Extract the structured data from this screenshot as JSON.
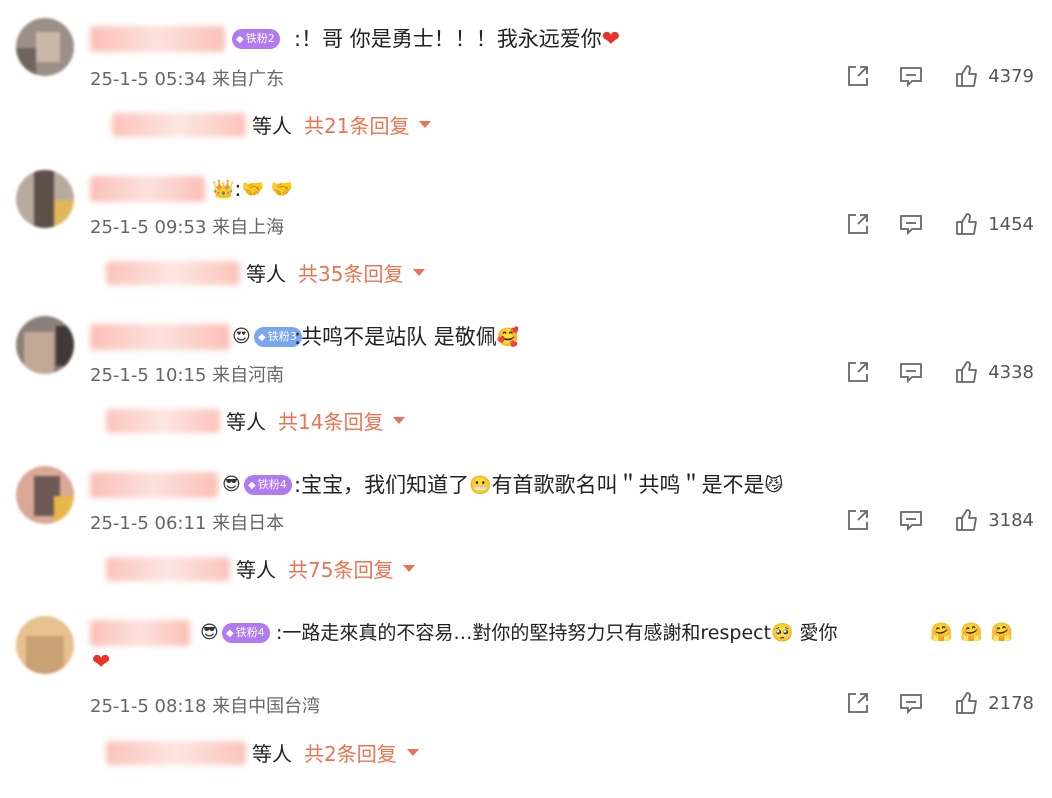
{
  "colors": {
    "accent": "#eb7350",
    "heart": "#e8322a",
    "badge": "#b07af0",
    "meta": "#666666"
  },
  "comments": [
    {
      "badge": "铁粉2",
      "text": ":！哥 你是勇士！！！我永远爱你",
      "emoji_tail": "heart",
      "time": "25-1-5 05:34",
      "location": "来自广东",
      "likes": "4379",
      "reply_suffix": "等人",
      "reply_count": "共21条回复"
    },
    {
      "badge": "",
      "text": ":",
      "emoji_tail": "handshake handshake",
      "time": "25-1-5 09:53",
      "location": "来自上海",
      "likes": "1454",
      "reply_suffix": "等人",
      "reply_count": "共35条回复"
    },
    {
      "badge": "铁粉3",
      "text": ":共鸣不是站队 是敬佩",
      "emoji_tail": "heart-eyes face",
      "time": "25-1-5 10:15",
      "location": "来自河南",
      "likes": "4338",
      "reply_suffix": "等人",
      "reply_count": "共14条回复"
    },
    {
      "badge": "铁粉4",
      "text_a": ":宝宝，我们知道了",
      "text_b": "有首歌歌名叫＂共鸣＂是不是",
      "time": "25-1-5 06:11",
      "location": "来自日本",
      "likes": "3184",
      "reply_suffix": "等人",
      "reply_count": "共75条回复"
    },
    {
      "badge": "铁粉4",
      "text_a": ":一路走來真的不容易…對你的堅持努力只有感謝和respect",
      "text_b": "愛你",
      "time": "25-1-5 08:18",
      "location": "来自中国台湾",
      "likes": "2178",
      "reply_suffix": "等人",
      "reply_count": "共2条回复"
    }
  ]
}
